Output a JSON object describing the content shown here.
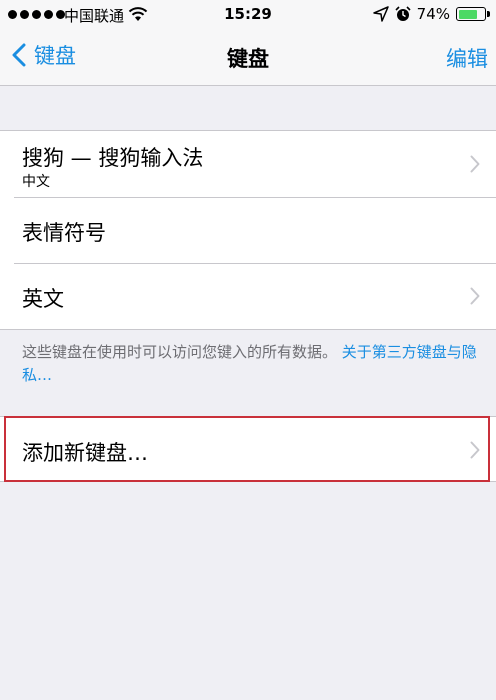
{
  "status_bar": {
    "carrier": "中国联通",
    "time": "15:29",
    "battery_percent": "74%",
    "battery_level": 0.74,
    "icons": [
      "signal-dots",
      "wifi-icon",
      "location-arrow-icon",
      "alarm-clock-icon",
      "battery-icon"
    ]
  },
  "nav": {
    "back_label": "键盘",
    "title": "键盘",
    "edit_label": "编辑"
  },
  "keyboards": [
    {
      "title": "搜狗 — 搜狗输入法",
      "subtitle": "中文"
    },
    {
      "title": "表情符号"
    },
    {
      "title": "英文"
    }
  ],
  "note": {
    "text": "这些键盘在使用时可以访问您键入的所有数据。",
    "link": "关于第三方键盘与隐私…"
  },
  "add_keyboard": {
    "label": "添加新键盘…"
  },
  "colors": {
    "accent": "#1a8ee1",
    "highlight_border": "#c9303a",
    "battery": "#4cd964"
  }
}
